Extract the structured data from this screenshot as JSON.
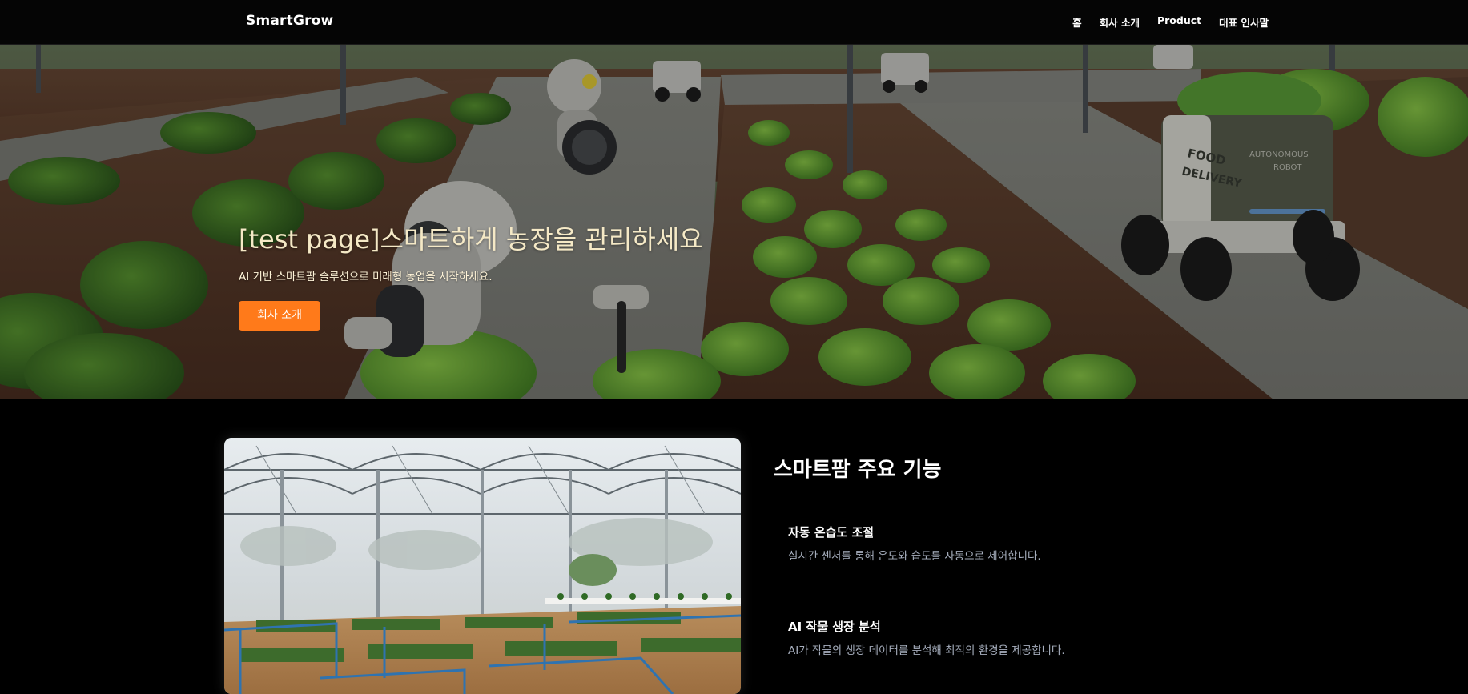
{
  "nav": {
    "brand": "SmartGrow",
    "links": [
      "홈",
      "회사 소개",
      "Product",
      "대표 인사말"
    ]
  },
  "hero": {
    "title": "[test page]스마트하게 농장을 관리하세요",
    "subtitle": "AI 기반 스마트팜 솔루션으로 미래형 농업을 시작하세요.",
    "button_label": "회사 소개"
  },
  "robot_labels": {
    "badge_line1": "FOOD",
    "badge_line2": "DELIVERY",
    "side_line1": "AUTONOMOUS",
    "side_line2": "ROBOT"
  },
  "features": {
    "title": "스마트팜 주요 기능",
    "items": [
      {
        "title": "자동 온습도 조절",
        "desc": "실시간 센서를 통해 온도와 습도를 자동으로 제어합니다."
      },
      {
        "title": "AI 작물 생장 분석",
        "desc": "AI가 작물의 생장 데이터를 분석해 최적의 환경을 제공합니다."
      }
    ]
  },
  "colors": {
    "accent": "#ff7a1a",
    "background": "#000000",
    "hero_title": "#f5e9c6",
    "feature_desc": "#a6aebd"
  }
}
